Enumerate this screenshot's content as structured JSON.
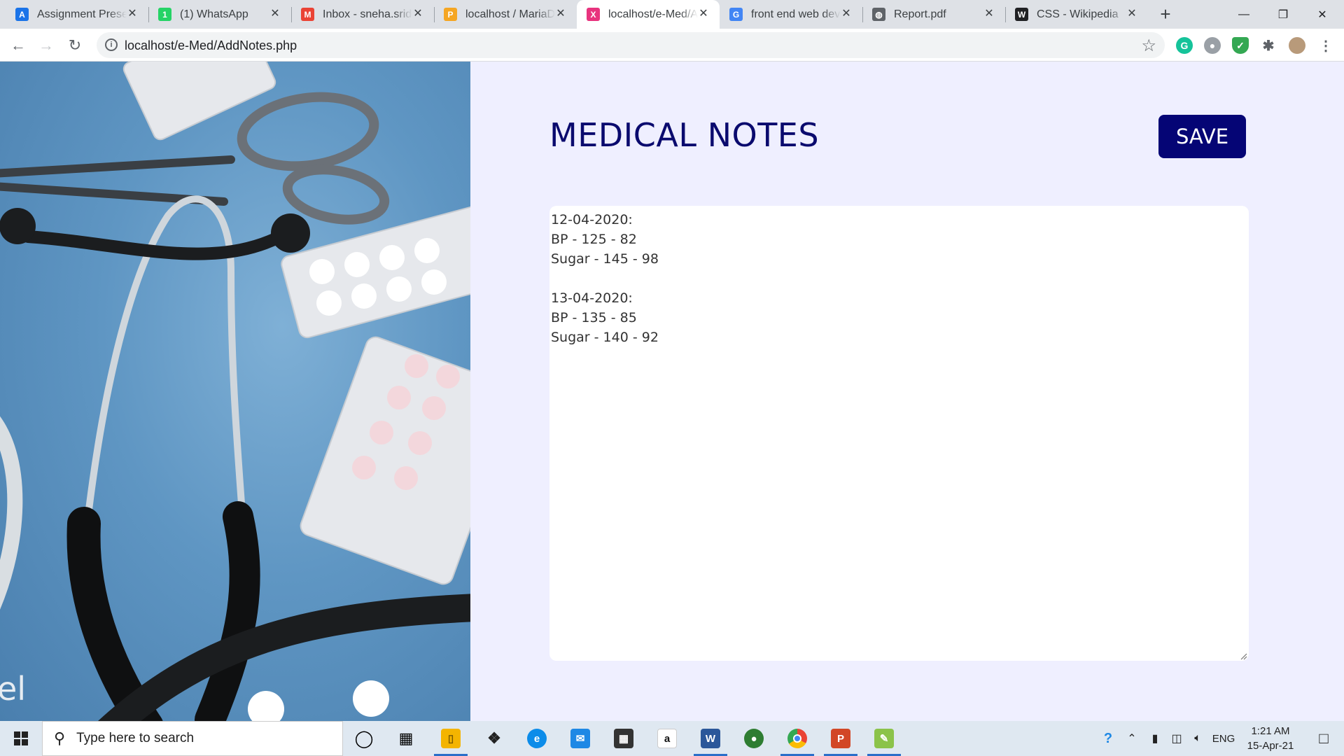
{
  "browser": {
    "tabs": [
      {
        "title": "Assignment Preser",
        "icon": "google-classroom-icon",
        "color": "#1a73e8",
        "glyph": "A",
        "active": false
      },
      {
        "title": "(1) WhatsApp",
        "icon": "whatsapp-icon",
        "color": "#25d366",
        "glyph": "1",
        "active": false
      },
      {
        "title": "Inbox - sneha.sridh",
        "icon": "gmail-icon",
        "color": "#ea4335",
        "glyph": "M",
        "active": false
      },
      {
        "title": "localhost / MariaD",
        "icon": "phpmyadmin-icon",
        "color": "#f5a623",
        "glyph": "P",
        "active": false
      },
      {
        "title": "localhost/e-Med/A",
        "icon": "xampp-icon",
        "color": "#e8337e",
        "glyph": "X",
        "active": true
      },
      {
        "title": "front end web dev",
        "icon": "google-icon",
        "color": "#4285f4",
        "glyph": "G",
        "active": false
      },
      {
        "title": "Report.pdf",
        "icon": "globe-icon",
        "color": "#5f6368",
        "glyph": "◍",
        "active": false
      },
      {
        "title": "CSS - Wikipedia",
        "icon": "wikipedia-icon",
        "color": "#202124",
        "glyph": "W",
        "active": false
      }
    ],
    "url": "localhost/e-Med/AddNotes.php"
  },
  "page": {
    "title": "MEDICAL NOTES",
    "save_label": "SAVE",
    "notes_text": "12-04-2020:\nBP - 125 - 82\nSugar - 145 - 98\n\n13-04-2020:\nBP - 135 - 85\nSugar - 140 - 92",
    "title_color": "#0a0a6e",
    "button_color": "#050575",
    "background_color": "#efefff"
  },
  "taskbar": {
    "search_placeholder": "Type here to search",
    "language": "ENG",
    "time": "1:21 AM",
    "date": "15-Apr-21"
  }
}
